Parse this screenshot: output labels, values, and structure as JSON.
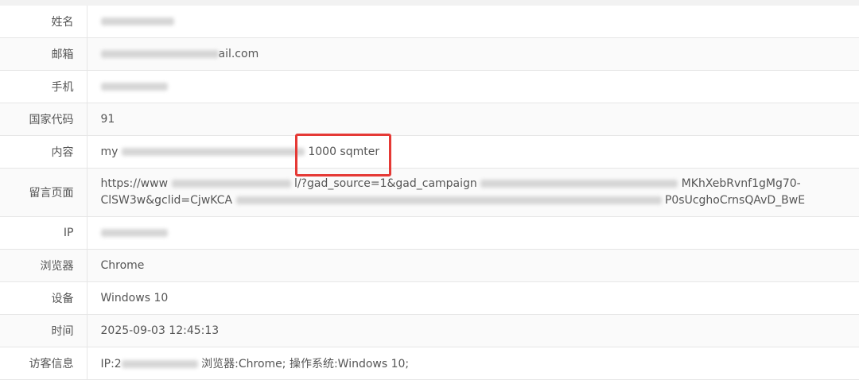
{
  "rows": [
    {
      "label": "姓名",
      "value": "",
      "redacted": true
    },
    {
      "label": "邮箱",
      "value_suffix": "ail.com"
    },
    {
      "label": "手机",
      "value": ""
    },
    {
      "label": "国家代码",
      "value": "91"
    },
    {
      "label": "内容",
      "prefix": "my",
      "suffix": "1000 sqmter"
    },
    {
      "label": "留言页面",
      "line1_prefix": "https://www",
      "line1_mid": "l/?gad_source=1&gad_campaign",
      "line1_end": "MKhXebRvnf1gMg70-",
      "line2_prefix": "ClSW3w&gclid=CjwKCA",
      "line2_end": "P0sUcghoCrnsQAvD_BwE"
    },
    {
      "label": "IP",
      "value": ""
    },
    {
      "label": "浏览器",
      "value": "Chrome"
    },
    {
      "label": "设备",
      "value": "Windows 10"
    },
    {
      "label": "时间",
      "value": "2025-09-03 12:45:13"
    },
    {
      "label": "访客信息",
      "ip_prefix": "IP:2",
      "rest": "浏览器:Chrome; 操作系统:Windows 10;"
    }
  ],
  "highlight_color": "#e53935"
}
